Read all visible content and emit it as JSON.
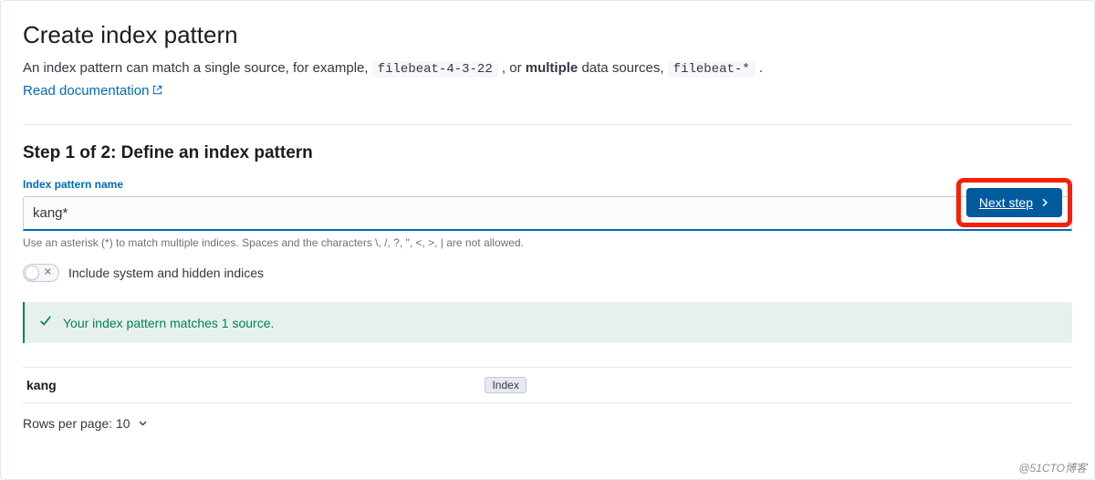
{
  "header": {
    "title": "Create index pattern",
    "description_prefix": "An index pattern can match a single source, for example, ",
    "code_single": "filebeat-4-3-22",
    "description_middle": " , or ",
    "bold_word": "multiple",
    "description_after_bold": " data sources, ",
    "code_multi": "filebeat-*",
    "description_suffix": " .",
    "doc_link_text": "Read documentation"
  },
  "step": {
    "title": "Step 1 of 2: Define an index pattern",
    "field_label": "Index pattern name",
    "input_value": "kang*",
    "help_text": "Use an asterisk (*) to match multiple indices. Spaces and the characters \\, /, ?, \", <, >, | are not allowed.",
    "next_button": "Next step"
  },
  "toggle": {
    "label": "Include system and hidden indices"
  },
  "callout": {
    "text": "Your index pattern matches 1 source."
  },
  "table": {
    "rows": [
      {
        "name": "kang",
        "badge": "Index"
      }
    ]
  },
  "pagination": {
    "label": "Rows per page: 10"
  },
  "watermark": "@51CTO博客"
}
